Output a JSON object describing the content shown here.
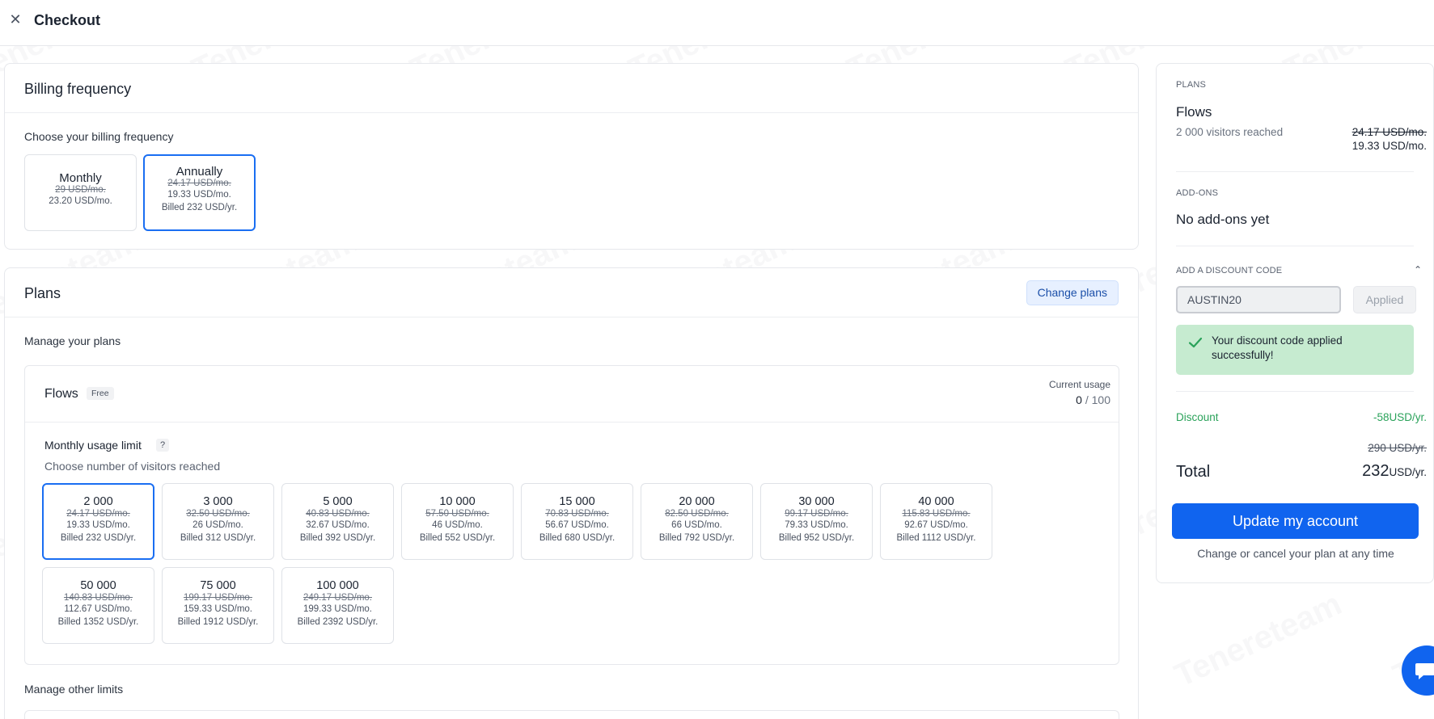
{
  "header": {
    "title": "Checkout",
    "close_icon": "close-icon"
  },
  "billing": {
    "title": "Billing frequency",
    "prompt": "Choose your billing frequency",
    "options": [
      {
        "name": "Monthly",
        "strike": "29 USD/mo.",
        "price": "23.20 USD/mo.",
        "billed": ""
      },
      {
        "name": "Annually",
        "strike": "24.17 USD/mo.",
        "price": "19.33 USD/mo.",
        "billed": "Billed 232 USD/yr."
      }
    ],
    "selected": "Annually"
  },
  "plans": {
    "title": "Plans",
    "change_button": "Change plans",
    "manage_label": "Manage your plans",
    "flows": {
      "name": "Flows",
      "badge": "Free",
      "current_usage_label": "Current usage",
      "usage_used": "0",
      "usage_sep": " / ",
      "usage_limit": "100",
      "limit_title": "Monthly usage limit",
      "help": "?",
      "limit_sub": "Choose number of visitors reached",
      "tiers": [
        {
          "name": "2 000",
          "strike": "24.17 USD/mo.",
          "price": "19.33 USD/mo.",
          "billed": "Billed 232 USD/yr."
        },
        {
          "name": "3 000",
          "strike": "32.50 USD/mo.",
          "price": "26 USD/mo.",
          "billed": "Billed 312 USD/yr."
        },
        {
          "name": "5 000",
          "strike": "40.83 USD/mo.",
          "price": "32.67 USD/mo.",
          "billed": "Billed 392 USD/yr."
        },
        {
          "name": "10 000",
          "strike": "57.50 USD/mo.",
          "price": "46 USD/mo.",
          "billed": "Billed 552 USD/yr."
        },
        {
          "name": "15 000",
          "strike": "70.83 USD/mo.",
          "price": "56.67 USD/mo.",
          "billed": "Billed 680 USD/yr."
        },
        {
          "name": "20 000",
          "strike": "82.50 USD/mo.",
          "price": "66 USD/mo.",
          "billed": "Billed 792 USD/yr."
        },
        {
          "name": "30 000",
          "strike": "99.17 USD/mo.",
          "price": "79.33 USD/mo.",
          "billed": "Billed 952 USD/yr."
        },
        {
          "name": "40 000",
          "strike": "115.83 USD/mo.",
          "price": "92.67 USD/mo.",
          "billed": "Billed 1112 USD/yr."
        },
        {
          "name": "50 000",
          "strike": "140.83 USD/mo.",
          "price": "112.67 USD/mo.",
          "billed": "Billed 1352 USD/yr."
        },
        {
          "name": "75 000",
          "strike": "199.17 USD/mo.",
          "price": "159.33 USD/mo.",
          "billed": "Billed 1912 USD/yr."
        },
        {
          "name": "100 000",
          "strike": "249.17 USD/mo.",
          "price": "199.33 USD/mo.",
          "billed": "Billed 2392 USD/yr."
        }
      ],
      "selected_tier": "2 000"
    },
    "other_limits_label": "Manage other limits"
  },
  "summary": {
    "plans_label": "PLANS",
    "plan_name": "Flows",
    "plan_sub": "2 000 visitors reached",
    "plan_strike": "24.17 USD/mo.",
    "plan_price": "19.33 USD/mo.",
    "addons_label": "ADD-ONS",
    "addons_value": "No add-ons yet",
    "discount_label": "ADD A DISCOUNT CODE",
    "discount_code": "AUSTIN20",
    "applied_button": "Applied",
    "success_message": "Your discount code applied successfully!",
    "discount_row_label": "Discount",
    "discount_row_value": "-58USD/yr.",
    "original_total": "290 USD/yr.",
    "total_label": "Total",
    "total_amount": "232",
    "total_unit": "USD/yr.",
    "update_button": "Update my account",
    "change_note": "Change or cancel your plan at any time"
  },
  "watermark_text": "Tenereteam",
  "colors": {
    "accent": "#1064ef",
    "selected_border": "#1a6ef2",
    "success_bg": "#c6ebd0",
    "discount_green": "#2aa25a"
  }
}
